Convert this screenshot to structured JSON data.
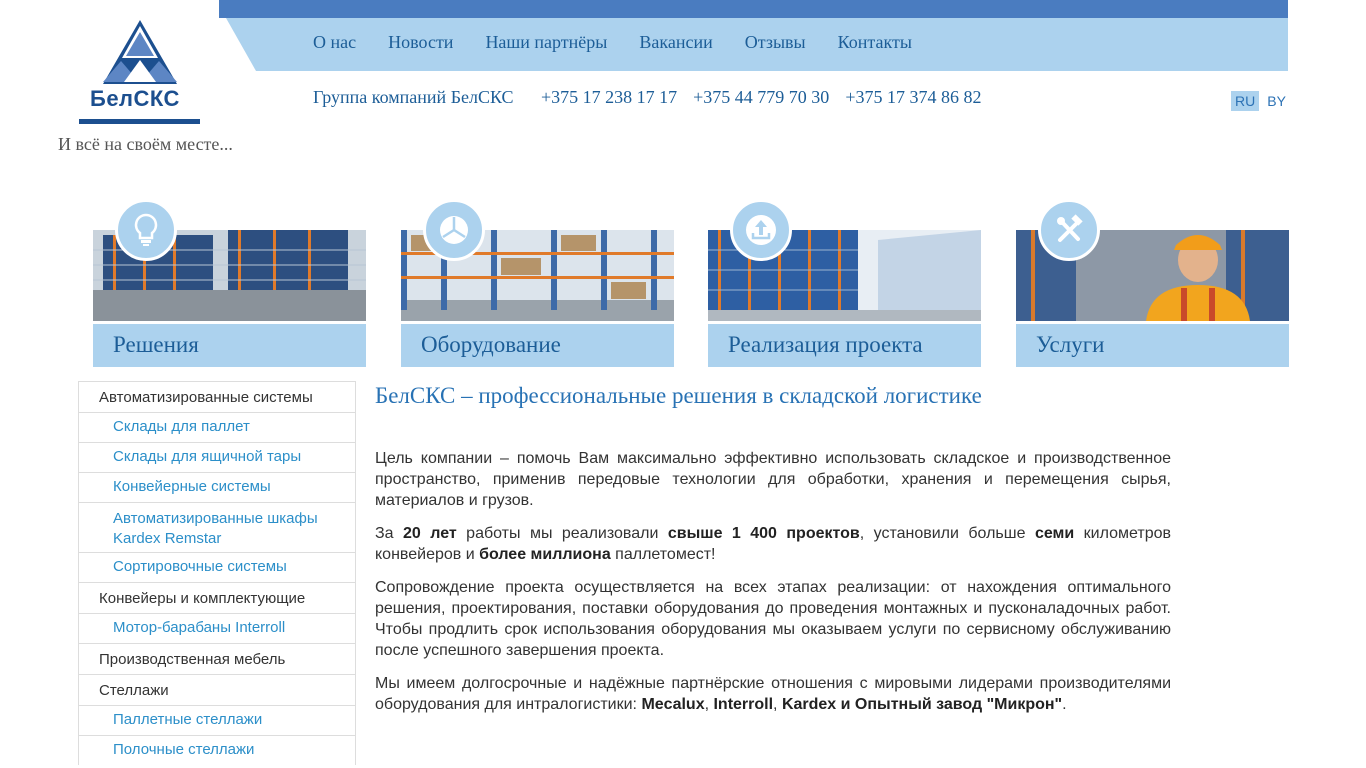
{
  "brand": {
    "logo_text": "БелСКС",
    "slogan": "И всё на своём месте...",
    "accent_dark": "#4a7cc0",
    "accent_light": "#acd2ee",
    "link_color": "#1c5d97"
  },
  "nav": {
    "items": [
      "О нас",
      "Новости",
      "Наши партнёры",
      "Вакансии",
      "Отзывы",
      "Контакты"
    ]
  },
  "contacts": {
    "group_name": "Группа компаний БелСКС",
    "phones": [
      "+375 17 238 17 17",
      "+375 44 779 70 30",
      "+375 17 374 86 82"
    ]
  },
  "lang": {
    "ru": "RU",
    "by": "BY",
    "active": "RU"
  },
  "cards": [
    {
      "label": "Решения",
      "icon": "lightbulb-icon"
    },
    {
      "label": "Оборудование",
      "icon": "cube-icon"
    },
    {
      "label": "Реализация проекта",
      "icon": "upload-icon"
    },
    {
      "label": "Услуги",
      "icon": "tools-icon"
    }
  ],
  "sidebar": {
    "items": [
      {
        "label": "Автоматизированные системы",
        "level": 1
      },
      {
        "label": "Склады для паллет",
        "level": 2
      },
      {
        "label": "Склады для ящичной тары",
        "level": 2
      },
      {
        "label": "Конвейерные системы",
        "level": 2
      },
      {
        "label": "Автоматизированные шкафы Kardex Remstar",
        "level": 2
      },
      {
        "label": "Сортировочные системы",
        "level": 2
      },
      {
        "label": "Конвейеры и комплектующие",
        "level": 1
      },
      {
        "label": "Мотор-барабаны Interroll",
        "level": 2
      },
      {
        "label": "Производственная мебель",
        "level": 1
      },
      {
        "label": "Стеллажи",
        "level": 1
      },
      {
        "label": "Паллетные стеллажи",
        "level": 2
      },
      {
        "label": "Полочные стеллажи",
        "level": 2
      }
    ]
  },
  "main": {
    "title": "БелСКС – профессиональные решения в складской логистике",
    "p1": "Цель компании – помочь Вам максимально эффективно использовать складское и производственное пространство, применив передовые технологии для обработки, хранения и перемещения сырья, материалов и грузов.",
    "p2": {
      "t1": "За ",
      "b1": "20 лет",
      "t2": " работы мы реализовали ",
      "b2": "свыше 1 400 проектов",
      "t3": ", установили больше ",
      "b3": "семи",
      "t4": " километров конвейеров и ",
      "b4": "более миллиона",
      "t5": " паллетомест!"
    },
    "p3": "Сопровождение проекта осуществляется на всех этапах реализации: от нахождения оптимального решения, проектирования, поставки оборудования до проведения монтажных и пусконаладочных работ. Чтобы продлить срок использования оборудования мы оказываем услуги по сервисному обслуживанию после успешного завершения проекта.",
    "p4": {
      "t1": "Мы имеем долгосрочные и надёжные партнёрские отношения с мировыми лидерами производителями оборудования для интралогистики: ",
      "b1": "Mecalux",
      "t2": ", ",
      "b2": "Interroll",
      "t3": ", ",
      "b3": "Kardex и Опытный завод \"Микрон\"",
      "t4": "."
    }
  }
}
